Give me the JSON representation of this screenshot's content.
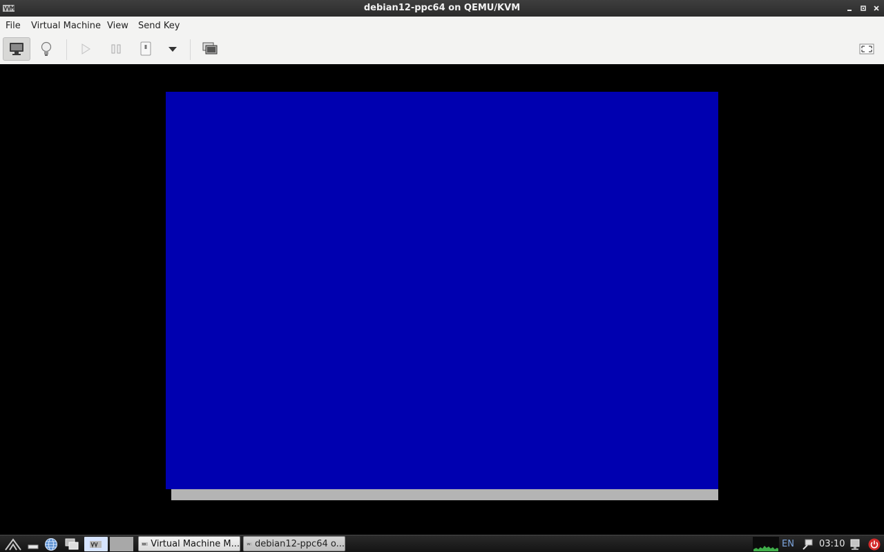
{
  "window": {
    "title": "debian12-ppc64 on QEMU/KVM"
  },
  "menubar": {
    "items": [
      "File",
      "Virtual Machine",
      "View",
      "Send Key"
    ]
  },
  "toolbar": {
    "buttons": [
      "console-view",
      "details-view",
      "run",
      "pause",
      "shutdown",
      "shutdown-menu",
      "snapshots",
      "fullscreen"
    ]
  },
  "console": {
    "screen_color": "#0000b0"
  },
  "taskbar": {
    "tasks": [
      {
        "label": "Virtual Machine M...",
        "active": true
      },
      {
        "label": "debian12-ppc64 o...",
        "active": false
      }
    ],
    "keyboard_layout": "EN",
    "clock": "03:10"
  }
}
